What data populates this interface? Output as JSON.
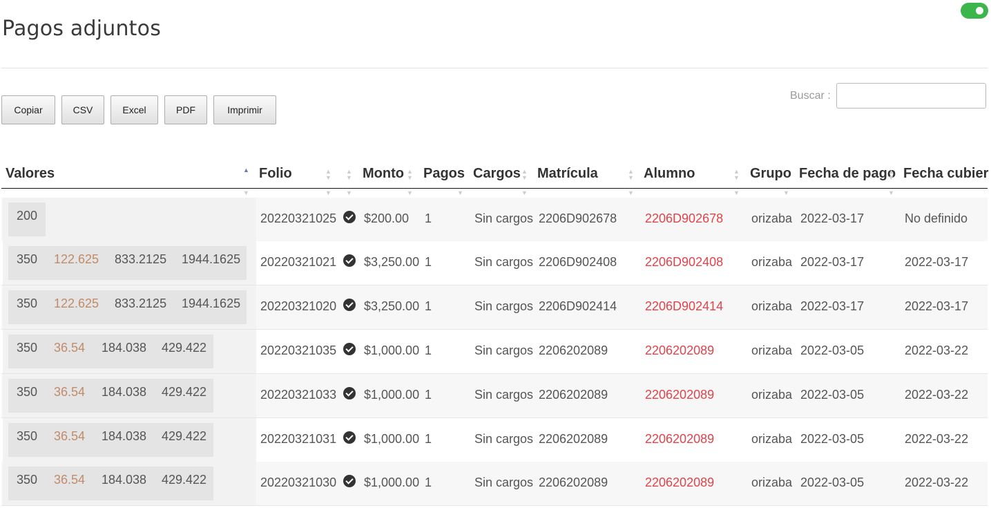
{
  "page": {
    "title": "Pagos adjuntos"
  },
  "toolbar": {
    "buttons": [
      "Copiar",
      "CSV",
      "Excel",
      "PDF",
      "Imprimir"
    ]
  },
  "search": {
    "label": "Buscar :",
    "value": ""
  },
  "table": {
    "columns": [
      "Valores",
      "Folio",
      "",
      "Monto",
      "Pagos",
      "Cargos",
      "Matrícula",
      "Alumno",
      "Grupo",
      "Fecha de pago",
      "Fecha cubier"
    ],
    "rows": [
      {
        "valores": [
          "200"
        ],
        "folio": "20220321025",
        "monto": "$200.00",
        "pagos": "1",
        "cargos": "Sin cargos",
        "matricula": "2206D902678",
        "alumno": "2206D902678",
        "grupo": "orizaba",
        "fecha_pago": "2022-03-17",
        "fecha_cubierta": "No definido"
      },
      {
        "valores": [
          "350",
          "122.625",
          "833.2125",
          "1944.1625"
        ],
        "folio": "20220321021",
        "monto": "$3,250.00",
        "pagos": "1",
        "cargos": "Sin cargos",
        "matricula": "2206D902408",
        "alumno": "2206D902408",
        "grupo": "orizaba",
        "fecha_pago": "2022-03-17",
        "fecha_cubierta": "2022-03-17"
      },
      {
        "valores": [
          "350",
          "122.625",
          "833.2125",
          "1944.1625"
        ],
        "folio": "20220321020",
        "monto": "$3,250.00",
        "pagos": "1",
        "cargos": "Sin cargos",
        "matricula": "2206D902414",
        "alumno": "2206D902414",
        "grupo": "orizaba",
        "fecha_pago": "2022-03-17",
        "fecha_cubierta": "2022-03-17"
      },
      {
        "valores": [
          "350",
          "36.54",
          "184.038",
          "429.422"
        ],
        "folio": "20220321035",
        "monto": "$1,000.00",
        "pagos": "1",
        "cargos": "Sin cargos",
        "matricula": "2206202089",
        "alumno": "2206202089",
        "grupo": "orizaba",
        "fecha_pago": "2022-03-05",
        "fecha_cubierta": "2022-03-22"
      },
      {
        "valores": [
          "350",
          "36.54",
          "184.038",
          "429.422"
        ],
        "folio": "20220321033",
        "monto": "$1,000.00",
        "pagos": "1",
        "cargos": "Sin cargos",
        "matricula": "2206202089",
        "alumno": "2206202089",
        "grupo": "orizaba",
        "fecha_pago": "2022-03-05",
        "fecha_cubierta": "2022-03-22"
      },
      {
        "valores": [
          "350",
          "36.54",
          "184.038",
          "429.422"
        ],
        "folio": "20220321031",
        "monto": "$1,000.00",
        "pagos": "1",
        "cargos": "Sin cargos",
        "matricula": "2206202089",
        "alumno": "2206202089",
        "grupo": "orizaba",
        "fecha_pago": "2022-03-05",
        "fecha_cubierta": "2022-03-22"
      },
      {
        "valores": [
          "350",
          "36.54",
          "184.038",
          "429.422"
        ],
        "folio": "20220321030",
        "monto": "$1,000.00",
        "pagos": "1",
        "cargos": "Sin cargos",
        "matricula": "2206202089",
        "alumno": "2206202089",
        "grupo": "orizaba",
        "fecha_pago": "2022-03-05",
        "fecha_cubierta": "2022-03-22"
      }
    ]
  },
  "colors": {
    "toggle": "#3cb54a",
    "link": "#e2434a",
    "secondary_value": "#c08b6a",
    "sort_active": "#6b74c8"
  },
  "icons": {
    "status": "check-circle-icon",
    "toggle": "toggle-switch-icon"
  }
}
